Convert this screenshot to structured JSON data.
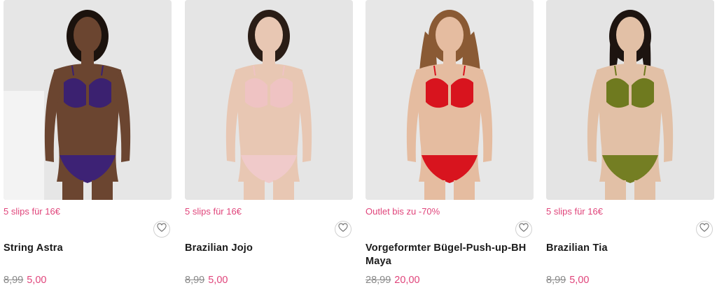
{
  "products": [
    {
      "promo": "5 slips für 16€",
      "name": "String Astra",
      "old_price": "8,99",
      "new_price": "5,00",
      "model": {
        "skin": "#6b4530",
        "hair": "#1b120d",
        "bra": "#3b2170",
        "panty": "#3d2275",
        "bg": "#e6e6e6"
      }
    },
    {
      "promo": "5 slips für 16€",
      "name": "Brazilian Jojo",
      "old_price": "8,99",
      "new_price": "5,00",
      "model": {
        "skin": "#e8c7b3",
        "hair": "#2a1d16",
        "bra": "#efc3c3",
        "panty": "#f0caca",
        "bg": "#e5e5e5"
      }
    },
    {
      "promo": "Outlet bis zu -70%",
      "name": "Vorgeformter Bügel-Push-up-BH Maya",
      "old_price": "28,99",
      "new_price": "20,00",
      "model": {
        "skin": "#e5bca0",
        "hair": "#8a5a34",
        "bra": "#d8141e",
        "panty": "#d8141e",
        "bg": "#e7e7e7"
      }
    },
    {
      "promo": "5 slips für 16€",
      "name": "Brazilian Tia",
      "old_price": "8,99",
      "new_price": "5,00",
      "model": {
        "skin": "#e2c0a6",
        "hair": "#1d1410",
        "bra": "#6f7a1f",
        "panty": "#747e23",
        "bg": "#e4e4e4"
      }
    }
  ],
  "icons": {
    "wishlist": "heart-icon"
  },
  "colors": {
    "promo": "#e0457b",
    "sale_price": "#e0457b",
    "old_price": "#8a8a8a"
  }
}
